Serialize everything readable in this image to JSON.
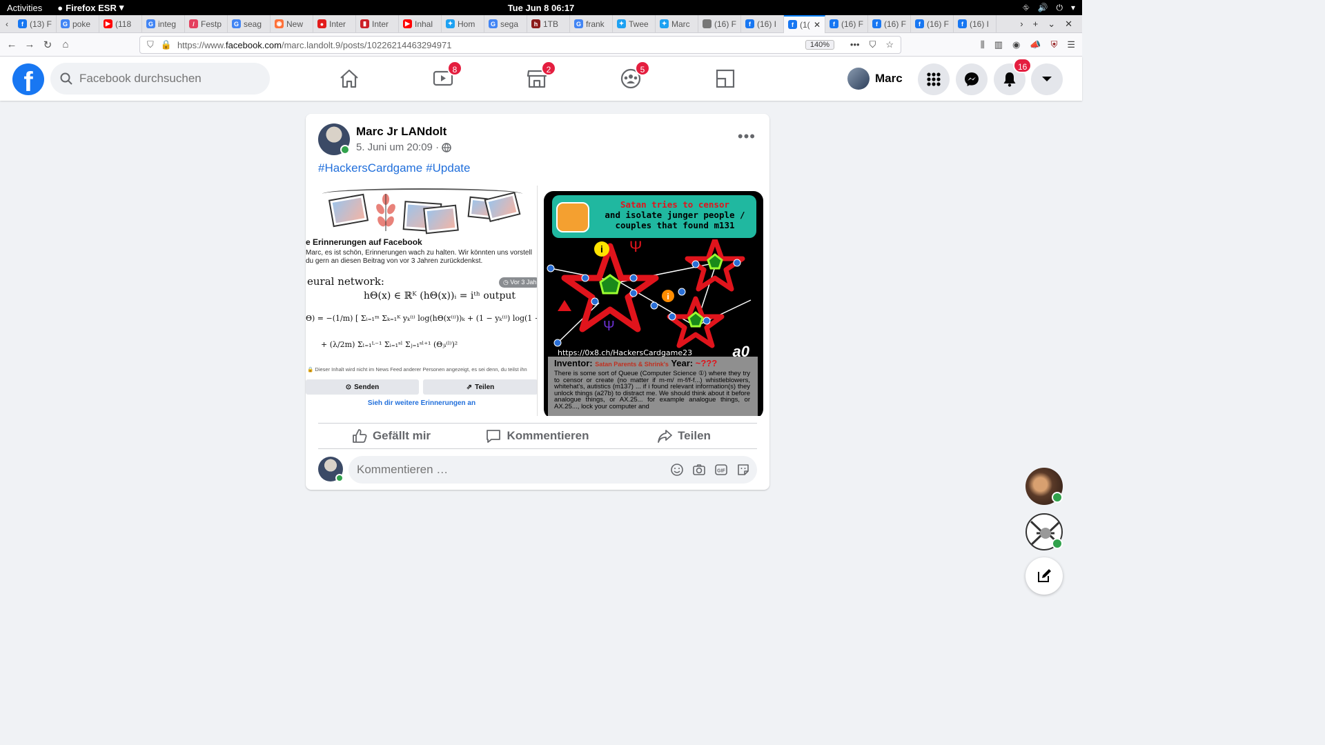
{
  "system": {
    "activities": "Activities",
    "app_name": "Firefox ESR",
    "clock": "Tue Jun 8  06:17"
  },
  "tabs": [
    {
      "title": "(13) F",
      "color": "#1877f2",
      "glyph": "f"
    },
    {
      "title": "poke",
      "color": "#4285f4",
      "glyph": "G"
    },
    {
      "title": "(118",
      "color": "#ff0000",
      "glyph": "▶"
    },
    {
      "title": "integ",
      "color": "#4285f4",
      "glyph": "G"
    },
    {
      "title": "Festp",
      "color": "#e4405f",
      "glyph": "/"
    },
    {
      "title": "seag",
      "color": "#4285f4",
      "glyph": "G"
    },
    {
      "title": "New",
      "color": "#ff7139",
      "glyph": "◉"
    },
    {
      "title": "Inter",
      "color": "#e21b1b",
      "glyph": "●"
    },
    {
      "title": "Inter",
      "color": "#cc1f26",
      "glyph": "▮"
    },
    {
      "title": "Inhal",
      "color": "#ff0000",
      "glyph": "▶"
    },
    {
      "title": "Hom",
      "color": "#1da1f2",
      "glyph": "✦"
    },
    {
      "title": "sega",
      "color": "#4285f4",
      "glyph": "G"
    },
    {
      "title": "1TB",
      "color": "#8b1a1a",
      "glyph": "h"
    },
    {
      "title": "frank",
      "color": "#4285f4",
      "glyph": "G"
    },
    {
      "title": "Twee",
      "color": "#1da1f2",
      "glyph": "✦"
    },
    {
      "title": "Marc",
      "color": "#1da1f2",
      "glyph": "✦"
    },
    {
      "title": "(16) Face",
      "color": "#777777",
      "glyph": ""
    },
    {
      "title": "(16) I",
      "color": "#1877f2",
      "glyph": "f"
    },
    {
      "title": "(1(",
      "color": "#1877f2",
      "glyph": "f",
      "active": true
    },
    {
      "title": "(16) F",
      "color": "#1877f2",
      "glyph": "f"
    },
    {
      "title": "(16) F",
      "color": "#1877f2",
      "glyph": "f"
    },
    {
      "title": "(16) F",
      "color": "#1877f2",
      "glyph": "f"
    },
    {
      "title": "(16) I",
      "color": "#1877f2",
      "glyph": "f"
    }
  ],
  "urlbar": {
    "prefix": "https://www.",
    "host": "facebook.com",
    "path": "/marc.landolt.9/posts/10226214463294971",
    "zoom": "140%"
  },
  "facebook": {
    "logo": "f",
    "search_placeholder": "Facebook durchsuchen",
    "badges": {
      "watch": "8",
      "marketplace": "2",
      "groups": "5",
      "notifications": "16"
    },
    "profile_name": "Marc",
    "colors": {
      "brand": "#1877f2",
      "badge": "#e41e3f",
      "online": "#31a24c",
      "link": "#216fdb"
    }
  },
  "post": {
    "author": "Marc Jr LANdolt",
    "timestamp": "5. Juni um 20:09 ·",
    "hashtags": [
      "#HackersCardgame",
      "#Update"
    ],
    "memory": {
      "title": "e Erinnerungen auf Facebook",
      "text": "Marc, es ist schön, Erinnerungen wach zu halten. Wir könnten uns vorstell du gern an diesen Beitrag von vor 3 Jahren zurückdenkst.",
      "heading": "eural network:",
      "ago": "Vor 3 Jah",
      "formula_1": "hΘ(x) ∈ ℝᴷ    (hΘ(x))ᵢ = iᵗʰ output",
      "formula_2": "Θ) = −(1/m) [ Σᵢ₌₁ᵐ Σₖ₌₁ᴷ yₖ⁽ⁱ⁾ log(hΘ(x⁽ⁱ⁾))ₖ + (1 − yₖ⁽ⁱ⁾) log(1 − (hΘ(x⁽ⁱ",
      "formula_3": "+ (λ/2m) Σₗ₌₁ᴸ⁻¹ Σᵢ₌₁ˢˡ Σⱼ₌₁ˢˡ⁺¹ (Θⱼᵢ⁽ˡ⁾)²",
      "notice": "🔒 Dieser Inhalt wird nicht im News Feed anderer Personen angezeigt, es sei denn, du teilst ihn",
      "send_label": "Senden",
      "share_label": "Teilen",
      "more_link": "Sieh dir weitere Erinnerungen an"
    },
    "card": {
      "banner_line1": "Satan tries to censor",
      "banner_line2": "and isolate junger people /",
      "banner_line3": "couples that found m131",
      "url": "https://0x8.ch/HackersCardgame23",
      "code": "a0",
      "inventor_label": "Inventor:",
      "inventor_value": "Satan Parents & Shrink's",
      "year_label": "Year:",
      "year_value": "~???",
      "description": "There is some sort of Queue (Computer Science ①) where they try to censor or create (no matter if m-m/ m-f/f-f...) whistleblowers, whitehat's, autistics (m137) ... if i found relevant information(s) they unlock things (a27b) to distract me. We should think about it before analogue things, or AX.25... for example analogue things, or AX.25..., lock your computer and"
    },
    "actions": {
      "like": "Gefällt mir",
      "comment": "Kommentieren",
      "share": "Teilen"
    },
    "comment_placeholder": "Kommentieren …"
  }
}
